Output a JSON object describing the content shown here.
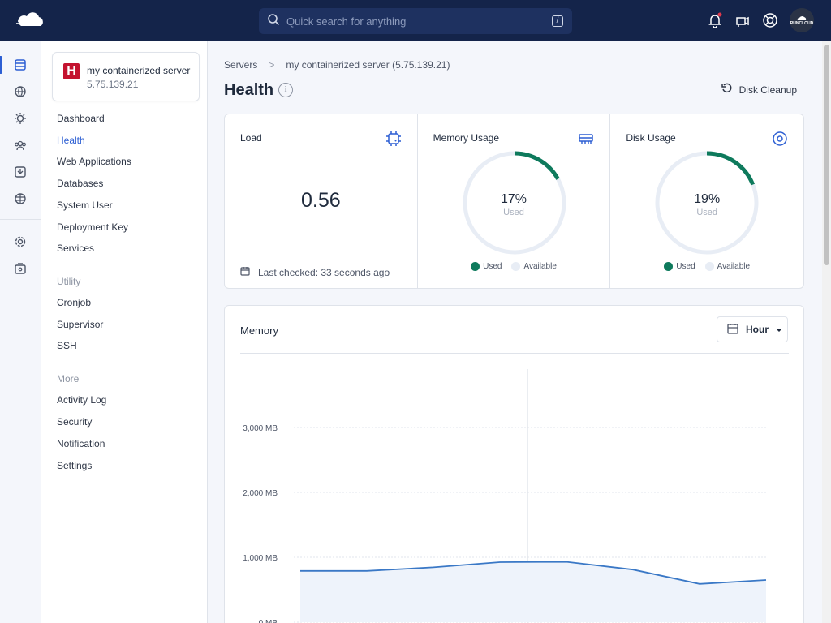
{
  "topbar": {
    "search_placeholder": "Quick search for anything",
    "slash_hint": "/",
    "avatar_text": "RUNCLOUD"
  },
  "server": {
    "badge_letter": "H",
    "name": "my containerized server",
    "ip": "5.75.139.21"
  },
  "nav": {
    "items": [
      "Dashboard",
      "Health",
      "Web Applications",
      "Databases",
      "System User",
      "Deployment Key",
      "Services"
    ],
    "active": "Health",
    "utility_heading": "Utility",
    "utility_items": [
      "Cronjob",
      "Supervisor",
      "SSH"
    ],
    "more_heading": "More",
    "more_items": [
      "Activity Log",
      "Security",
      "Notification",
      "Settings"
    ]
  },
  "breadcrumb": {
    "root": "Servers",
    "separator": ">",
    "current": "my containerized server (5.75.139.21)"
  },
  "page": {
    "title": "Health",
    "info_symbol": "i",
    "cleanup_label": "Disk Cleanup"
  },
  "load": {
    "title": "Load",
    "value": "0.56",
    "last_checked": "Last checked: 33 seconds ago"
  },
  "memory_usage": {
    "title": "Memory Usage",
    "percent": "17%",
    "percent_value": 17,
    "sublabel": "Used",
    "legend_used": "Used",
    "legend_available": "Available"
  },
  "disk_usage": {
    "title": "Disk Usage",
    "percent": "19%",
    "percent_value": 19,
    "sublabel": "Used",
    "legend_used": "Used",
    "legend_available": "Available"
  },
  "memory_panel": {
    "title": "Memory",
    "range_label": "Hour"
  },
  "colors": {
    "topbar": "#14244a",
    "accent": "#2d5fd3",
    "used": "#0e7a5c",
    "available": "#e8edf5",
    "line": "#3a78c6",
    "area": "#eef3fb"
  },
  "chart_data": {
    "type": "area",
    "title": "Memory",
    "y_ticks": [
      "3,000 MB",
      "2,000 MB",
      "1,000 MB",
      "0 MB"
    ],
    "y_tick_values": [
      3000,
      2000,
      1000,
      0
    ],
    "ylim": [
      0,
      3000
    ],
    "x": [
      0,
      1,
      2,
      3,
      4,
      5,
      6,
      7
    ],
    "values": [
      790,
      790,
      845,
      925,
      930,
      810,
      590,
      650
    ],
    "grid": true
  }
}
